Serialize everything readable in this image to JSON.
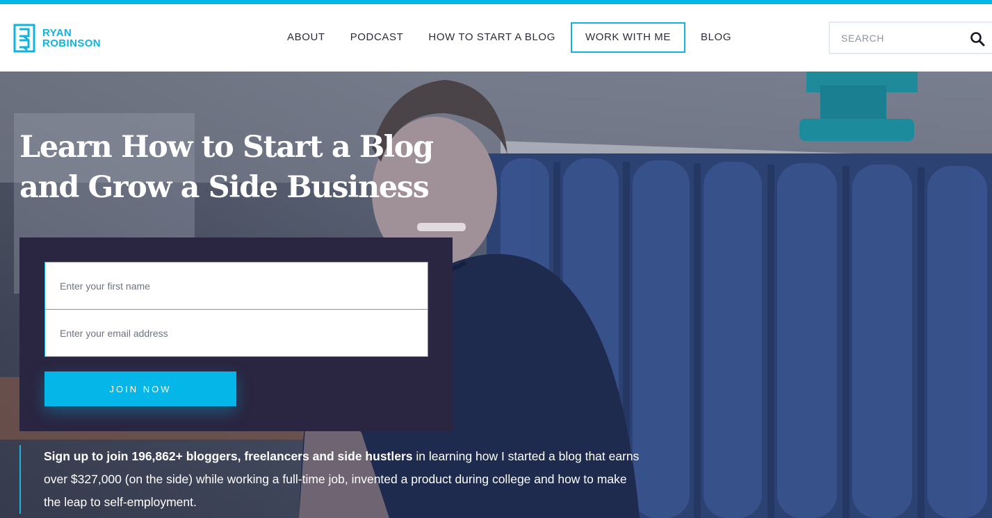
{
  "brand": {
    "name_line1": "RYAN",
    "name_line2": "ROBINSON",
    "accent": "#0fb3e0",
    "dark_panel": "#2a2540"
  },
  "nav": {
    "items": [
      {
        "label": "ABOUT"
      },
      {
        "label": "PODCAST"
      },
      {
        "label": "HOW TO START A BLOG"
      },
      {
        "label": "WORK WITH ME"
      },
      {
        "label": "BLOG"
      }
    ]
  },
  "search": {
    "placeholder": "SEARCH",
    "icon": "search-icon"
  },
  "hero": {
    "headline_line1": "Learn How to Start a Blog",
    "headline_line2": "and Grow a Side Business"
  },
  "signup": {
    "first_name_placeholder": "Enter your first name",
    "email_placeholder": "Enter your email address",
    "button_label": "JOIN NOW"
  },
  "blurb": {
    "lead": "Sign up to join 196,862+ bloggers, freelancers and side hustlers",
    "rest": " in learning how I started a blog that earns over $327,000 (on the side) while working a full-time job, invented a product during college and how to make the leap to self-employment."
  }
}
